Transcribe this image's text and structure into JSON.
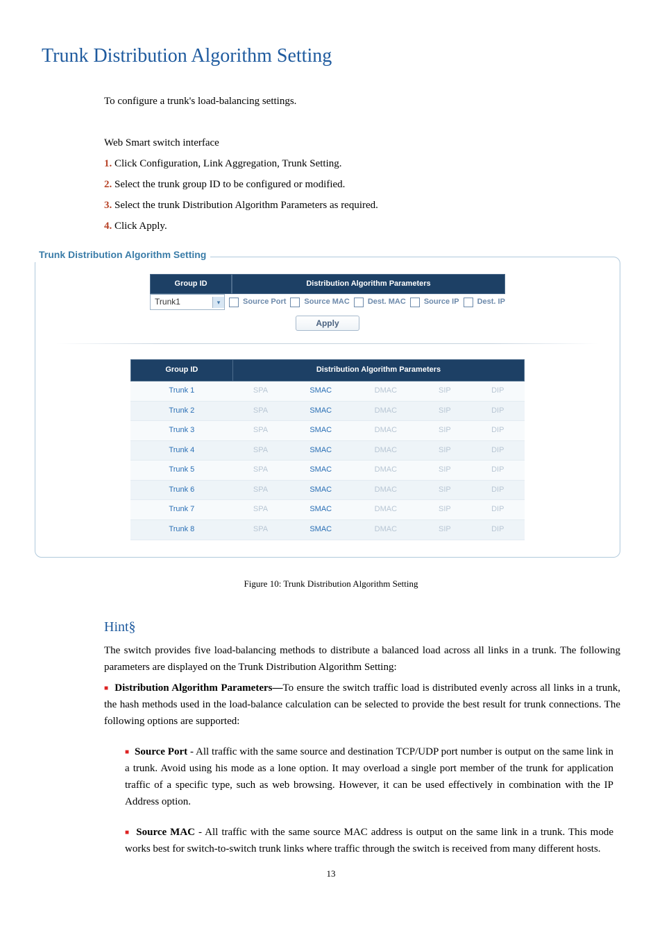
{
  "heading": "Trunk Distribution Algorithm Setting",
  "intro": "To configure a trunk's load-balancing settings.",
  "web_smart_line": "Web Smart switch interface",
  "steps": {
    "s1_num": "1.",
    "s1_text": " Click Configuration, Link Aggregation, Trunk Setting.",
    "s2_num": "2.",
    "s2_text": " Select the trunk group ID to be configured or modified.",
    "s3_num": "3.",
    "s3_text": " Select the trunk Distribution Algorithm Parameters as required.",
    "s4_num": "4.",
    "s4_text": " Click Apply."
  },
  "panel": {
    "legend": "Trunk Distribution Algorithm Setting",
    "header_group": "Group ID",
    "header_params": "Distribution Algorithm Parameters",
    "selected_group": "Trunk1",
    "params": {
      "p1": "Source Port",
      "p2": "Source MAC",
      "p3": "Dest. MAC",
      "p4": "Source IP",
      "p5": "Dest. IP"
    },
    "apply_label": "Apply"
  },
  "table": {
    "col_group": "Group ID",
    "col_params": "Distribution Algorithm Parameters",
    "rows": [
      {
        "g": "Trunk 1",
        "spa": "SPA",
        "smac": "SMAC",
        "dmac": "DMAC",
        "sip": "SIP",
        "dip": "DIP"
      },
      {
        "g": "Trunk 2",
        "spa": "SPA",
        "smac": "SMAC",
        "dmac": "DMAC",
        "sip": "SIP",
        "dip": "DIP"
      },
      {
        "g": "Trunk 3",
        "spa": "SPA",
        "smac": "SMAC",
        "dmac": "DMAC",
        "sip": "SIP",
        "dip": "DIP"
      },
      {
        "g": "Trunk 4",
        "spa": "SPA",
        "smac": "SMAC",
        "dmac": "DMAC",
        "sip": "SIP",
        "dip": "DIP"
      },
      {
        "g": "Trunk 5",
        "spa": "SPA",
        "smac": "SMAC",
        "dmac": "DMAC",
        "sip": "SIP",
        "dip": "DIP"
      },
      {
        "g": "Trunk 6",
        "spa": "SPA",
        "smac": "SMAC",
        "dmac": "DMAC",
        "sip": "SIP",
        "dip": "DIP"
      },
      {
        "g": "Trunk 7",
        "spa": "SPA",
        "smac": "SMAC",
        "dmac": "DMAC",
        "sip": "SIP",
        "dip": "DIP"
      },
      {
        "g": "Trunk 8",
        "spa": "SPA",
        "smac": "SMAC",
        "dmac": "DMAC",
        "sip": "SIP",
        "dip": "DIP"
      }
    ]
  },
  "figure_caption": "Figure 10: Trunk Distribution Algorithm Setting",
  "hint": {
    "title": "Hint§",
    "intro1": "The switch provides five load-balancing methods to distribute a balanced load across all links in a trunk. The following parameters are displayed on the Trunk Distribution Algorithm Setting:",
    "dap_label": "Distribution Algorithm Parameters—",
    "dap_text": "To ensure the switch traffic load is distributed evenly across all links in a trunk, the hash methods used in the load-balance calculation can be selected to provide the best result for trunk connections. The following options are supported:",
    "sp_label": "Source Port",
    "sp_text": " - All traffic with the same source and destination TCP/UDP port number is output on the same link in a trunk. Avoid using his mode as a lone option. It may overload a single port member of the trunk for application traffic of a specific type, such as web browsing. However, it can be used effectively in combination with the IP Address option.",
    "sm_label": "Source MAC",
    "sm_text": " - All traffic with the same source MAC address is output on the same link in a trunk. This mode works best for switch-to-switch trunk links where traffic through the switch is received from many different hosts."
  },
  "page_number": "13"
}
